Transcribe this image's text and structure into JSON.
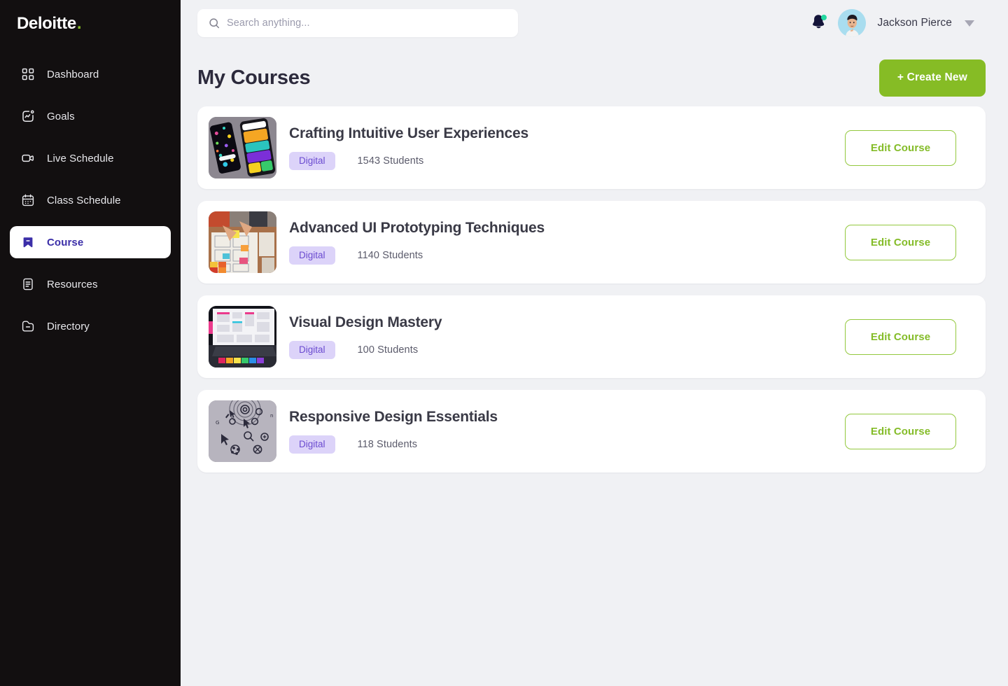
{
  "brand": {
    "name": "Deloitte",
    "dot": "."
  },
  "sidebar": {
    "items": [
      {
        "label": "Dashboard",
        "icon": "grid-icon",
        "active": false
      },
      {
        "label": "Goals",
        "icon": "chart-square-icon",
        "active": false
      },
      {
        "label": "Live Schedule",
        "icon": "video-camera-icon",
        "active": false
      },
      {
        "label": "Class Schedule",
        "icon": "calendar-icon",
        "active": false
      },
      {
        "label": "Course",
        "icon": "bookmark-icon",
        "active": true
      },
      {
        "label": "Resources",
        "icon": "document-icon",
        "active": false
      },
      {
        "label": "Directory",
        "icon": "folder-minus-icon",
        "active": false
      }
    ]
  },
  "topbar": {
    "search": {
      "placeholder": "Search anything...",
      "value": ""
    },
    "notifications": {
      "icon": "bell-icon",
      "has_unread": true,
      "dot_color": "#24D8A0"
    },
    "user": {
      "name": "Jackson Pierce",
      "avatar": "user-avatar",
      "caret": "chevron-down-icon"
    }
  },
  "page": {
    "title": "My Courses",
    "create_button": "+ Create New"
  },
  "courses": [
    {
      "title": "Crafting Intuitive User Experiences",
      "badge": "Digital",
      "students": "1543 Students",
      "action": "Edit Course",
      "thumb": "phones-colorful"
    },
    {
      "title": "Advanced UI Prototyping Techniques",
      "badge": "Digital",
      "students": "1140 Students",
      "action": "Edit Course",
      "thumb": "desk-wireframes"
    },
    {
      "title": "Visual Design Mastery",
      "badge": "Digital",
      "students": "100 Students",
      "action": "Edit Course",
      "thumb": "laptop-screen"
    },
    {
      "title": "Responsive Design Essentials",
      "badge": "Digital",
      "students": "118 Students",
      "action": "Edit Course",
      "thumb": "icons-grid"
    }
  ],
  "colors": {
    "brand_green": "#86BC25",
    "sidebar_bg": "#120F10",
    "page_bg": "#F0F1F4",
    "accent_indigo": "#3B2EA8",
    "badge_bg": "#DCD3F9",
    "badge_text": "#6B4BD0",
    "status_dot": "#24D8A0"
  }
}
